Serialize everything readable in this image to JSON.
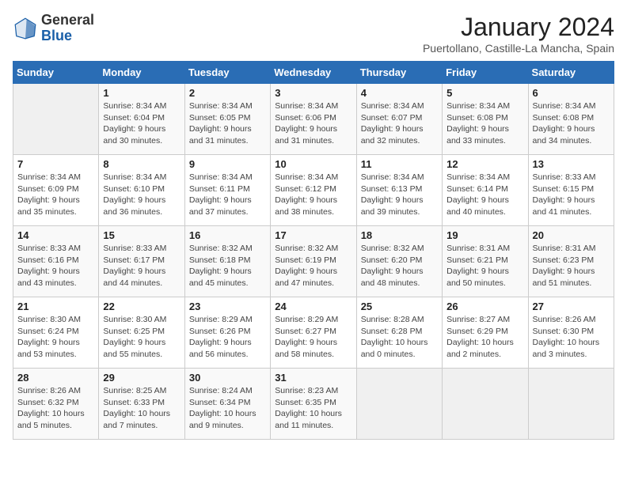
{
  "header": {
    "logo_general": "General",
    "logo_blue": "Blue",
    "month_year": "January 2024",
    "location": "Puertollano, Castille-La Mancha, Spain"
  },
  "weekdays": [
    "Sunday",
    "Monday",
    "Tuesday",
    "Wednesday",
    "Thursday",
    "Friday",
    "Saturday"
  ],
  "weeks": [
    [
      {
        "day": "",
        "sunrise": "",
        "sunset": "",
        "daylight": ""
      },
      {
        "day": "1",
        "sunrise": "Sunrise: 8:34 AM",
        "sunset": "Sunset: 6:04 PM",
        "daylight": "Daylight: 9 hours and 30 minutes."
      },
      {
        "day": "2",
        "sunrise": "Sunrise: 8:34 AM",
        "sunset": "Sunset: 6:05 PM",
        "daylight": "Daylight: 9 hours and 31 minutes."
      },
      {
        "day": "3",
        "sunrise": "Sunrise: 8:34 AM",
        "sunset": "Sunset: 6:06 PM",
        "daylight": "Daylight: 9 hours and 31 minutes."
      },
      {
        "day": "4",
        "sunrise": "Sunrise: 8:34 AM",
        "sunset": "Sunset: 6:07 PM",
        "daylight": "Daylight: 9 hours and 32 minutes."
      },
      {
        "day": "5",
        "sunrise": "Sunrise: 8:34 AM",
        "sunset": "Sunset: 6:08 PM",
        "daylight": "Daylight: 9 hours and 33 minutes."
      },
      {
        "day": "6",
        "sunrise": "Sunrise: 8:34 AM",
        "sunset": "Sunset: 6:08 PM",
        "daylight": "Daylight: 9 hours and 34 minutes."
      }
    ],
    [
      {
        "day": "7",
        "sunrise": "Sunrise: 8:34 AM",
        "sunset": "Sunset: 6:09 PM",
        "daylight": "Daylight: 9 hours and 35 minutes."
      },
      {
        "day": "8",
        "sunrise": "Sunrise: 8:34 AM",
        "sunset": "Sunset: 6:10 PM",
        "daylight": "Daylight: 9 hours and 36 minutes."
      },
      {
        "day": "9",
        "sunrise": "Sunrise: 8:34 AM",
        "sunset": "Sunset: 6:11 PM",
        "daylight": "Daylight: 9 hours and 37 minutes."
      },
      {
        "day": "10",
        "sunrise": "Sunrise: 8:34 AM",
        "sunset": "Sunset: 6:12 PM",
        "daylight": "Daylight: 9 hours and 38 minutes."
      },
      {
        "day": "11",
        "sunrise": "Sunrise: 8:34 AM",
        "sunset": "Sunset: 6:13 PM",
        "daylight": "Daylight: 9 hours and 39 minutes."
      },
      {
        "day": "12",
        "sunrise": "Sunrise: 8:34 AM",
        "sunset": "Sunset: 6:14 PM",
        "daylight": "Daylight: 9 hours and 40 minutes."
      },
      {
        "day": "13",
        "sunrise": "Sunrise: 8:33 AM",
        "sunset": "Sunset: 6:15 PM",
        "daylight": "Daylight: 9 hours and 41 minutes."
      }
    ],
    [
      {
        "day": "14",
        "sunrise": "Sunrise: 8:33 AM",
        "sunset": "Sunset: 6:16 PM",
        "daylight": "Daylight: 9 hours and 43 minutes."
      },
      {
        "day": "15",
        "sunrise": "Sunrise: 8:33 AM",
        "sunset": "Sunset: 6:17 PM",
        "daylight": "Daylight: 9 hours and 44 minutes."
      },
      {
        "day": "16",
        "sunrise": "Sunrise: 8:32 AM",
        "sunset": "Sunset: 6:18 PM",
        "daylight": "Daylight: 9 hours and 45 minutes."
      },
      {
        "day": "17",
        "sunrise": "Sunrise: 8:32 AM",
        "sunset": "Sunset: 6:19 PM",
        "daylight": "Daylight: 9 hours and 47 minutes."
      },
      {
        "day": "18",
        "sunrise": "Sunrise: 8:32 AM",
        "sunset": "Sunset: 6:20 PM",
        "daylight": "Daylight: 9 hours and 48 minutes."
      },
      {
        "day": "19",
        "sunrise": "Sunrise: 8:31 AM",
        "sunset": "Sunset: 6:21 PM",
        "daylight": "Daylight: 9 hours and 50 minutes."
      },
      {
        "day": "20",
        "sunrise": "Sunrise: 8:31 AM",
        "sunset": "Sunset: 6:23 PM",
        "daylight": "Daylight: 9 hours and 51 minutes."
      }
    ],
    [
      {
        "day": "21",
        "sunrise": "Sunrise: 8:30 AM",
        "sunset": "Sunset: 6:24 PM",
        "daylight": "Daylight: 9 hours and 53 minutes."
      },
      {
        "day": "22",
        "sunrise": "Sunrise: 8:30 AM",
        "sunset": "Sunset: 6:25 PM",
        "daylight": "Daylight: 9 hours and 55 minutes."
      },
      {
        "day": "23",
        "sunrise": "Sunrise: 8:29 AM",
        "sunset": "Sunset: 6:26 PM",
        "daylight": "Daylight: 9 hours and 56 minutes."
      },
      {
        "day": "24",
        "sunrise": "Sunrise: 8:29 AM",
        "sunset": "Sunset: 6:27 PM",
        "daylight": "Daylight: 9 hours and 58 minutes."
      },
      {
        "day": "25",
        "sunrise": "Sunrise: 8:28 AM",
        "sunset": "Sunset: 6:28 PM",
        "daylight": "Daylight: 10 hours and 0 minutes."
      },
      {
        "day": "26",
        "sunrise": "Sunrise: 8:27 AM",
        "sunset": "Sunset: 6:29 PM",
        "daylight": "Daylight: 10 hours and 2 minutes."
      },
      {
        "day": "27",
        "sunrise": "Sunrise: 8:26 AM",
        "sunset": "Sunset: 6:30 PM",
        "daylight": "Daylight: 10 hours and 3 minutes."
      }
    ],
    [
      {
        "day": "28",
        "sunrise": "Sunrise: 8:26 AM",
        "sunset": "Sunset: 6:32 PM",
        "daylight": "Daylight: 10 hours and 5 minutes."
      },
      {
        "day": "29",
        "sunrise": "Sunrise: 8:25 AM",
        "sunset": "Sunset: 6:33 PM",
        "daylight": "Daylight: 10 hours and 7 minutes."
      },
      {
        "day": "30",
        "sunrise": "Sunrise: 8:24 AM",
        "sunset": "Sunset: 6:34 PM",
        "daylight": "Daylight: 10 hours and 9 minutes."
      },
      {
        "day": "31",
        "sunrise": "Sunrise: 8:23 AM",
        "sunset": "Sunset: 6:35 PM",
        "daylight": "Daylight: 10 hours and 11 minutes."
      },
      {
        "day": "",
        "sunrise": "",
        "sunset": "",
        "daylight": ""
      },
      {
        "day": "",
        "sunrise": "",
        "sunset": "",
        "daylight": ""
      },
      {
        "day": "",
        "sunrise": "",
        "sunset": "",
        "daylight": ""
      }
    ]
  ]
}
